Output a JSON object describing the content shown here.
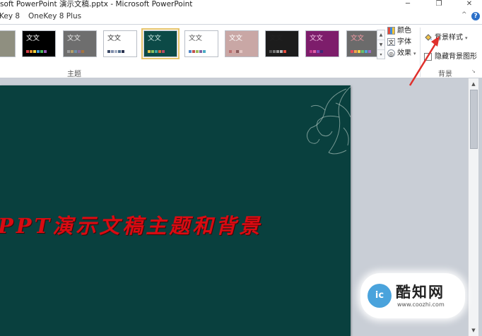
{
  "window": {
    "title": "soft PowerPoint 演示文稿.pptx - Microsoft PowerPoint",
    "minimize": "─",
    "restore": "❐",
    "close": "✕",
    "collapse_ribbon": "^",
    "help": "?"
  },
  "tabs": [
    "Key 8",
    "OneKey 8 Plus"
  ],
  "ribbon": {
    "themes_label": "主题",
    "themes": [
      {
        "text": "",
        "bg": "#8f8f80",
        "fg": "#ffffff",
        "swatches": [
          "#c9b77a",
          "#7c9a6b",
          "#5d6e7e",
          "#a7563c"
        ]
      },
      {
        "text": "文文",
        "bg": "#000000",
        "fg": "#ffffff",
        "swatches": [
          "#d8404b",
          "#e08f2f",
          "#f3d43a",
          "#3d9ad9",
          "#4cba5d",
          "#9457b5"
        ]
      },
      {
        "text": "文文",
        "bg": "#6e6e6e",
        "fg": "#e6e6e6",
        "swatches": [
          "#9e9e9e",
          "#b5a06b",
          "#6c8fa8",
          "#8a6c9c",
          "#a3743f"
        ]
      },
      {
        "text": "文文",
        "bg": "#ffffff",
        "fg": "#333333",
        "swatches": [
          "#3c4a66",
          "#7e8cab",
          "#a6b0c4",
          "#4d6a8a",
          "#2a3350"
        ]
      },
      {
        "text": "文文",
        "bg": "#0c4a47",
        "fg": "#c8e6e0",
        "swatches": [
          "#e0c14a",
          "#8fc05e",
          "#3fa6a1",
          "#d76c3b",
          "#b54a62"
        ],
        "selected": true
      },
      {
        "text": "文文",
        "bg": "#ffffff",
        "fg": "#555555",
        "swatches": [
          "#4f86c6",
          "#c0504d",
          "#9bbb59",
          "#8064a2",
          "#4bacc6"
        ]
      },
      {
        "text": "文文",
        "bg": "#c9a7a5",
        "fg": "#ffffff",
        "swatches": [
          "#b96f6f",
          "#d9a3a0",
          "#8c5c5c",
          "#e4c7c4"
        ]
      },
      {
        "text": "文文",
        "bg": "#1c1c1c",
        "fg": "#222222",
        "swatches": [
          "#555555",
          "#777777",
          "#999999",
          "#bbbbbb",
          "#e84c3d"
        ]
      },
      {
        "text": "文文",
        "bg": "#7d1d6b",
        "fg": "#f5c6ea",
        "swatches": [
          "#c2378f",
          "#e15fa8",
          "#7c4ab8",
          "#3e2a78"
        ]
      },
      {
        "text": "文文",
        "bg": "#6b6b6b",
        "fg": "#f39aa3",
        "swatches": [
          "#e2485b",
          "#f6a04a",
          "#f5d547",
          "#6bc26b",
          "#4ea5da",
          "#9c6bc9"
        ]
      }
    ],
    "gallery_up": "▲",
    "gallery_down": "▼",
    "gallery_more": "▾",
    "colors_label": "颜色",
    "colors_icon": "▦",
    "fonts_label": "字体",
    "fonts_icon": "文",
    "effects_label": "效果",
    "effects_icon": "◎",
    "background_label": "背景",
    "bg_styles_label": "背景样式",
    "hide_bg_label": "隐藏背景图形",
    "dropdown_arrow": "▾",
    "launcher": "↘"
  },
  "slide": {
    "title": "PPT演示文稿主题和背景",
    "bg_color": "#09403e",
    "title_color": "#d90b12"
  },
  "scroll": {
    "up": "▲",
    "down": "▼"
  },
  "watermark": {
    "logo_text": "ic",
    "name": "酷知网",
    "url": "www.coozhi.com"
  }
}
